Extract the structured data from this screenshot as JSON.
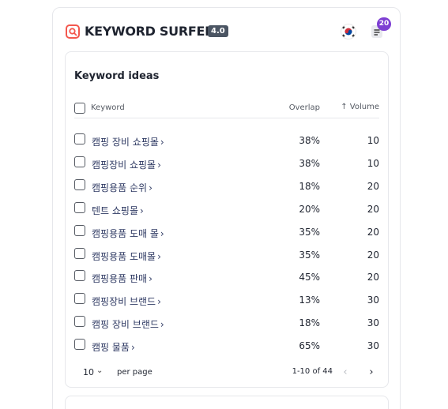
{
  "app": {
    "brand": "KEYWORD SURFER",
    "version": "4.0",
    "notification_count": "20",
    "colors": {
      "accent": "#f3584e",
      "badge": "#7e3fd3",
      "link": "#2f3a63"
    },
    "icons": {
      "logo": "surfer-logo-icon",
      "flag": "korea-flag-icon",
      "notes": "notes-icon"
    }
  },
  "keyword_ideas": {
    "title": "Keyword ideas",
    "columns": {
      "keyword": "Keyword",
      "overlap": "Overlap",
      "volume": "Volume",
      "sort_arrow": "↑"
    },
    "rows": [
      {
        "keyword": "캠핑 장비 쇼핑몰",
        "overlap": "38%",
        "volume": "10"
      },
      {
        "keyword": "캠핑장비 쇼핑몰",
        "overlap": "38%",
        "volume": "10"
      },
      {
        "keyword": "캠핑용품 순위",
        "overlap": "18%",
        "volume": "20"
      },
      {
        "keyword": "텐트 쇼핑몰",
        "overlap": "20%",
        "volume": "20"
      },
      {
        "keyword": "캠핑용품 도매 몰",
        "overlap": "35%",
        "volume": "20"
      },
      {
        "keyword": "캠핑용품 도매몰",
        "overlap": "35%",
        "volume": "20"
      },
      {
        "keyword": "캠핑용품 판매",
        "overlap": "45%",
        "volume": "20"
      },
      {
        "keyword": "캠핑장비 브랜드",
        "overlap": "13%",
        "volume": "30"
      },
      {
        "keyword": "캠핑 장비 브랜드",
        "overlap": "18%",
        "volume": "30"
      },
      {
        "keyword": "캠핑 물품",
        "overlap": "65%",
        "volume": "30"
      }
    ],
    "pagination": {
      "per_page_value": "10",
      "per_page_label": "per page",
      "range": "1-10 of 44",
      "prev": "‹",
      "next": "›"
    }
  }
}
